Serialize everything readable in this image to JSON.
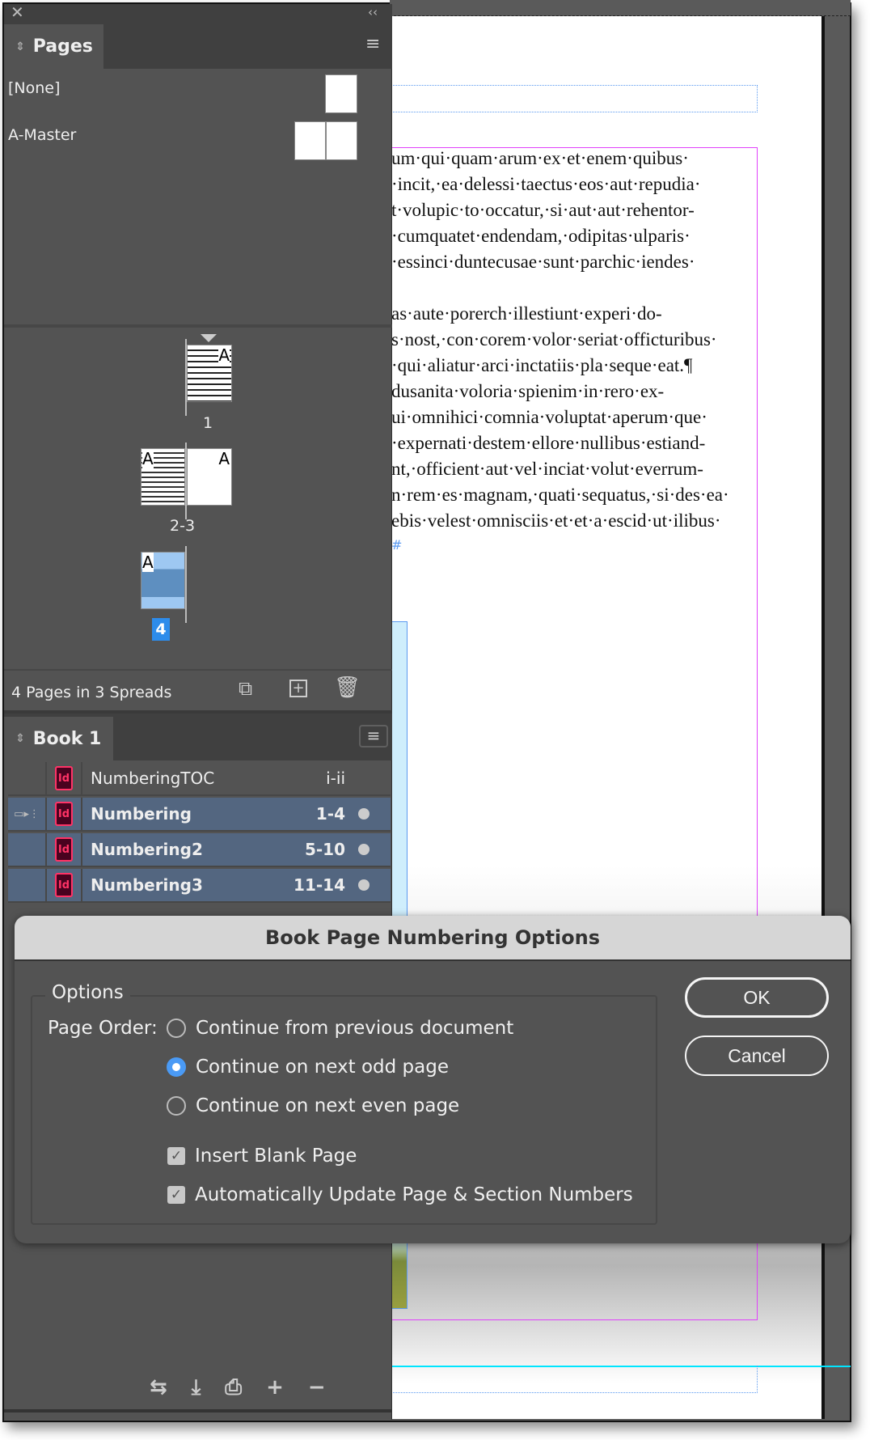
{
  "document": {
    "lines": [
      "um·qui·quam·arum·ex·et·enem·quibus·",
      "·incit,·ea·delessi·taectus·eos·aut·repudia·",
      "t·volupic·to·occatur,·si·aut·aut·rehentor-",
      "·cumquatet·endendam,·odipitas·ulparis·",
      "·essinci·duntecusae·sunt·parchic·iendes·",
      "",
      "as·aute·porerch·illestiunt·experi·do-",
      "s·nost,·con·corem·volor·seriat·officturibus·",
      "·qui·aliatur·arci·inctatiis·pla·seque·eat.¶",
      "dusanita·voloria·spienim·in·rero·ex-",
      "ui·omnihici·comnia·voluptat·aperum·que·",
      "·expernati·destem·ellore·nullibus·estiand-",
      "nt,·officient·aut·vel·inciat·volut·everrum-",
      "n·rem·es·magnam,·quati·sequatus,·si·des·ea·",
      "ebis·velest·omnisciis·et·et·a·escid·ut·ilibus·"
    ],
    "end_mark": "#"
  },
  "pages_panel": {
    "tab_label": "Pages",
    "masters": [
      {
        "name": "[None]"
      },
      {
        "name": "A-Master"
      }
    ],
    "spreads": [
      {
        "label": "1",
        "master": "A"
      },
      {
        "label": "2-3",
        "master": "A"
      },
      {
        "label": "4",
        "master": "A",
        "selected": true
      }
    ],
    "status": "4 Pages in 3 Spreads"
  },
  "book_panel": {
    "tab_label": "Book 1",
    "documents": [
      {
        "icon": "Id",
        "name": "NumberingTOC",
        "range": "i-ii",
        "selected": false
      },
      {
        "icon": "Id",
        "name": "Numbering",
        "range": "1-4",
        "selected": true
      },
      {
        "icon": "Id",
        "name": "Numbering2",
        "range": "5-10",
        "selected": true
      },
      {
        "icon": "Id",
        "name": "Numbering3",
        "range": "11-14",
        "selected": true
      }
    ]
  },
  "dialog": {
    "title": "Book Page Numbering Options",
    "group_label": "Options",
    "page_order_label": "Page Order:",
    "radios": [
      {
        "label": "Continue from previous document",
        "checked": false
      },
      {
        "label": "Continue on next odd page",
        "checked": true
      },
      {
        "label": "Continue on next even page",
        "checked": false
      }
    ],
    "checkboxes": [
      {
        "label": "Insert Blank Page",
        "checked": true
      },
      {
        "label": "Automatically Update Page & Section Numbers",
        "checked": true
      }
    ],
    "ok_label": "OK",
    "cancel_label": "Cancel"
  },
  "colors": {
    "selection": "#536680",
    "accent": "#2d8ceb",
    "margin_guide": "#e040fb"
  }
}
